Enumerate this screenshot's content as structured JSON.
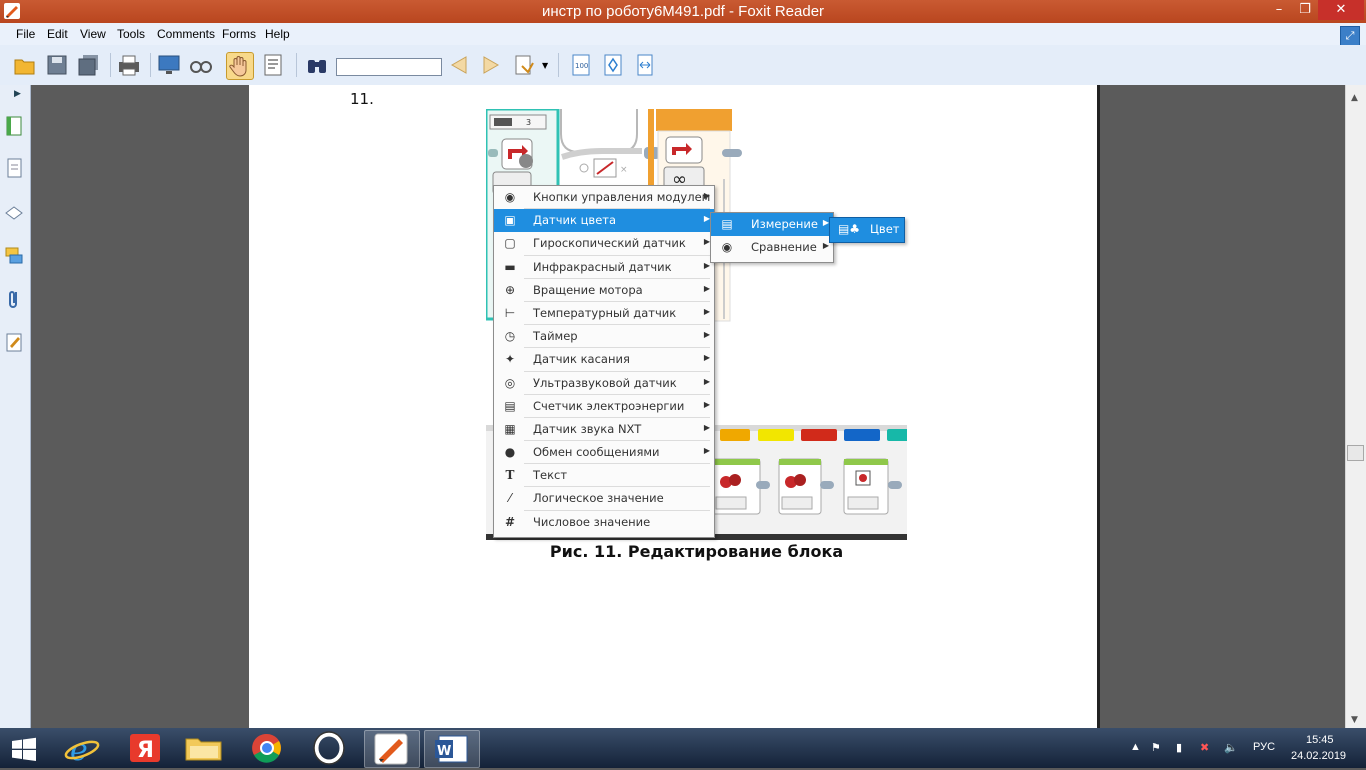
{
  "window": {
    "title": "инстр по роботу6М491.pdf - Foxit Reader"
  },
  "menubar": {
    "items": [
      "File",
      "Edit",
      "View",
      "Tools",
      "Comments",
      "Forms",
      "Help"
    ]
  },
  "toolbar": {
    "find_value": ""
  },
  "document": {
    "top_text": "11.",
    "caption": "Рис. 11. Редактирование блока",
    "block_counter": "3"
  },
  "context_menu": {
    "items": [
      {
        "label": "Кнопки управления модулем",
        "icon": "brick-buttons-icon"
      },
      {
        "label": "Датчик цвета",
        "icon": "color-sensor-icon"
      },
      {
        "label": "Гироскопический датчик",
        "icon": "gyro-sensor-icon"
      },
      {
        "label": "Инфракрасный датчик",
        "icon": "infrared-sensor-icon"
      },
      {
        "label": "Вращение мотора",
        "icon": "motor-rotation-icon"
      },
      {
        "label": "Температурный датчик",
        "icon": "temperature-sensor-icon"
      },
      {
        "label": "Таймер",
        "icon": "timer-icon"
      },
      {
        "label": "Датчик касания",
        "icon": "touch-sensor-icon"
      },
      {
        "label": "Ультразвуковой датчик",
        "icon": "ultrasonic-sensor-icon"
      },
      {
        "label": "Счетчик электроэнергии",
        "icon": "energy-meter-icon"
      },
      {
        "label": "Датчик звука NXT",
        "icon": "sound-sensor-icon"
      },
      {
        "label": "Обмен сообщениями",
        "icon": "bluetooth-icon"
      },
      {
        "label": "Текст",
        "icon": "text-icon"
      },
      {
        "label": "Логическое значение",
        "icon": "logic-icon"
      },
      {
        "label": "Числовое значение",
        "icon": "number-icon"
      }
    ],
    "selected_index": 1
  },
  "submenu": {
    "items": [
      {
        "label": "Измерение",
        "icon": "measure-icon"
      },
      {
        "label": "Сравнение",
        "icon": "compare-icon"
      }
    ],
    "selected_index": 0
  },
  "submenu2": {
    "items": [
      {
        "label": "Цвет",
        "icon": "color-icon"
      }
    ]
  },
  "palette": {
    "colors": [
      "#f0a800",
      "#f2e600",
      "#d12a1a",
      "#1366c8",
      "#17b8a8"
    ]
  },
  "taskbar": {
    "time": "15:45",
    "date": "24.02.2019",
    "language": "РУС",
    "apps": [
      "start",
      "internet-explorer",
      "yandex",
      "file-explorer",
      "chrome",
      "opera",
      "foxit-reader",
      "word"
    ]
  },
  "colors": {
    "title_bar": "#c4522a",
    "selection": "#1f8ee0",
    "ribbon": "#e4edf9"
  }
}
